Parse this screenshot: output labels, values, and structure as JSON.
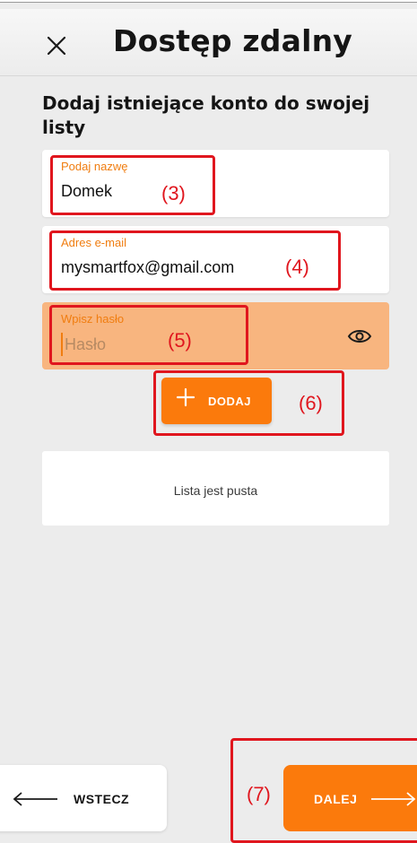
{
  "header": {
    "title": "Dostęp zdalny",
    "close_icon": "close-icon"
  },
  "subtitle": "Dodaj istniejące konto do swojej listy",
  "form": {
    "name": {
      "label": "Podaj nazwę",
      "value": "Domek"
    },
    "email": {
      "label": "Adres e-mail",
      "value": "mysmartfox@gmail.com"
    },
    "password": {
      "label": "Wpisz hasło",
      "placeholder": "Hasło",
      "value": "",
      "icon": "eye-icon"
    }
  },
  "add_button": {
    "label": "DODAJ",
    "icon": "plus-icon"
  },
  "list": {
    "empty_text": "Lista jest pusta"
  },
  "footer": {
    "back_label": "WSTECZ",
    "back_icon": "arrow-left-icon",
    "next_label": "DALEJ",
    "next_icon": "arrow-right-icon"
  },
  "annotations": [
    "(3)",
    "(4)",
    "(5)",
    "(6)",
    "(7)"
  ],
  "colors": {
    "accent": "#fb7a0c",
    "label": "#f07d10",
    "password_field_bg": "#f8b57f",
    "annotation": "#e0161e",
    "background": "#ececec"
  }
}
